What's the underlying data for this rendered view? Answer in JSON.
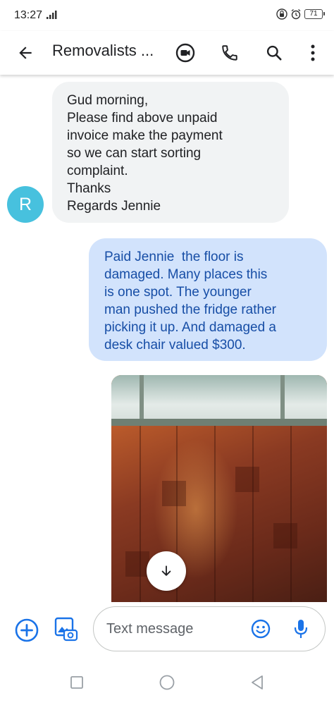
{
  "status_bar": {
    "time": "13:27",
    "battery": "71"
  },
  "conversation": {
    "title": "Removalists ..."
  },
  "messages": {
    "incoming": {
      "avatar_letter": "R",
      "lines": [
        "Gud morning,",
        "Please find above unpaid",
        "invoice make the payment",
        "so we can start sorting",
        "complaint.",
        "Thanks",
        "Regards Jennie"
      ]
    },
    "outgoing": {
      "lines": [
        "Paid Jennie  the floor is",
        "damaged. Many places this",
        "is one spot. The younger",
        "man pushed the fridge rather",
        "picking it up. And damaged a",
        "desk chair valued $300."
      ]
    }
  },
  "compose": {
    "placeholder": "Text message"
  },
  "icons": {
    "back": "arrow-back-icon",
    "video": "video-call-icon",
    "call": "phone-icon",
    "search": "search-icon",
    "more": "more-vert-icon",
    "add": "add-circle-icon",
    "media": "gallery-icon",
    "emoji": "emoji-icon",
    "mic": "mic-icon",
    "scroll": "arrow-down-icon"
  },
  "colors": {
    "accent": "#1a73e8",
    "incoming_bubble": "#f1f3f4",
    "outgoing_bubble": "#d2e3fc",
    "outgoing_text": "#174ea6",
    "avatar": "#47c1de"
  }
}
